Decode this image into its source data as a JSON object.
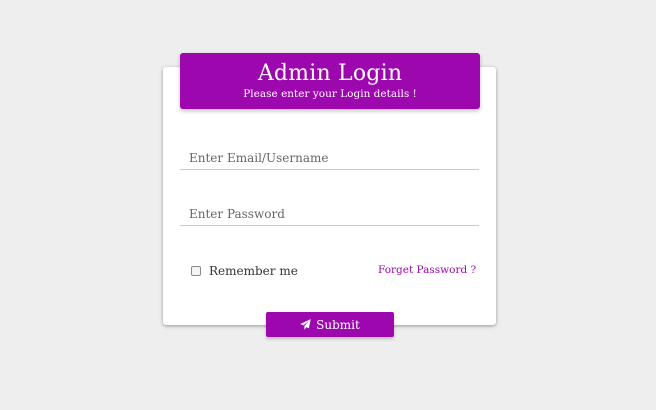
{
  "theme": {
    "accent": "#9c08ad",
    "background": "#eeeeee",
    "card": "#ffffff"
  },
  "header": {
    "title": "Admin Login",
    "subtitle": "Please enter your Login details !"
  },
  "form": {
    "email": {
      "placeholder": "Enter Email/Username",
      "value": ""
    },
    "password": {
      "placeholder": "Enter Password",
      "value": ""
    },
    "remember": {
      "label": "Remember me",
      "checked": false
    },
    "forgot_label": "Forget Password ?",
    "submit": {
      "label": "Submit",
      "icon": "paper-plane-icon"
    }
  }
}
